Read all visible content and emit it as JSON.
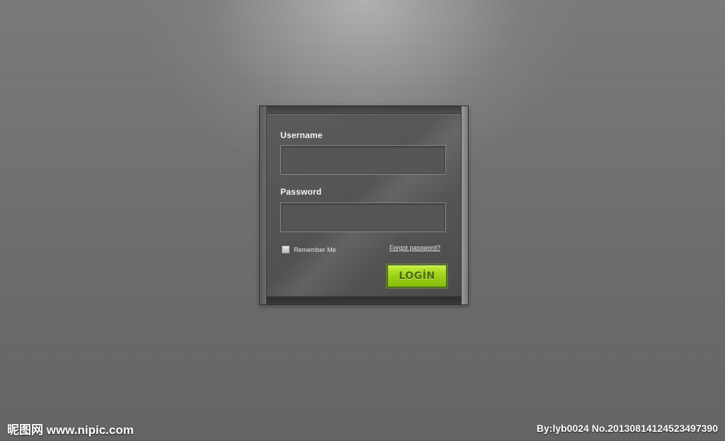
{
  "login_form": {
    "username_label": "Username",
    "username_value": "",
    "password_label": "Password",
    "password_value": "",
    "remember_label": "Remember Me",
    "remember_checked": false,
    "forgot_label": "Forgot password?",
    "login_label": "LOGİN"
  },
  "watermark": {
    "site": "昵图网 www.nipic.com",
    "credit": "By:lyb0024  No.20130814124523497390"
  },
  "colors": {
    "login_button": "#9fd419",
    "panel": "#555555",
    "background": "#6f6f6f"
  }
}
